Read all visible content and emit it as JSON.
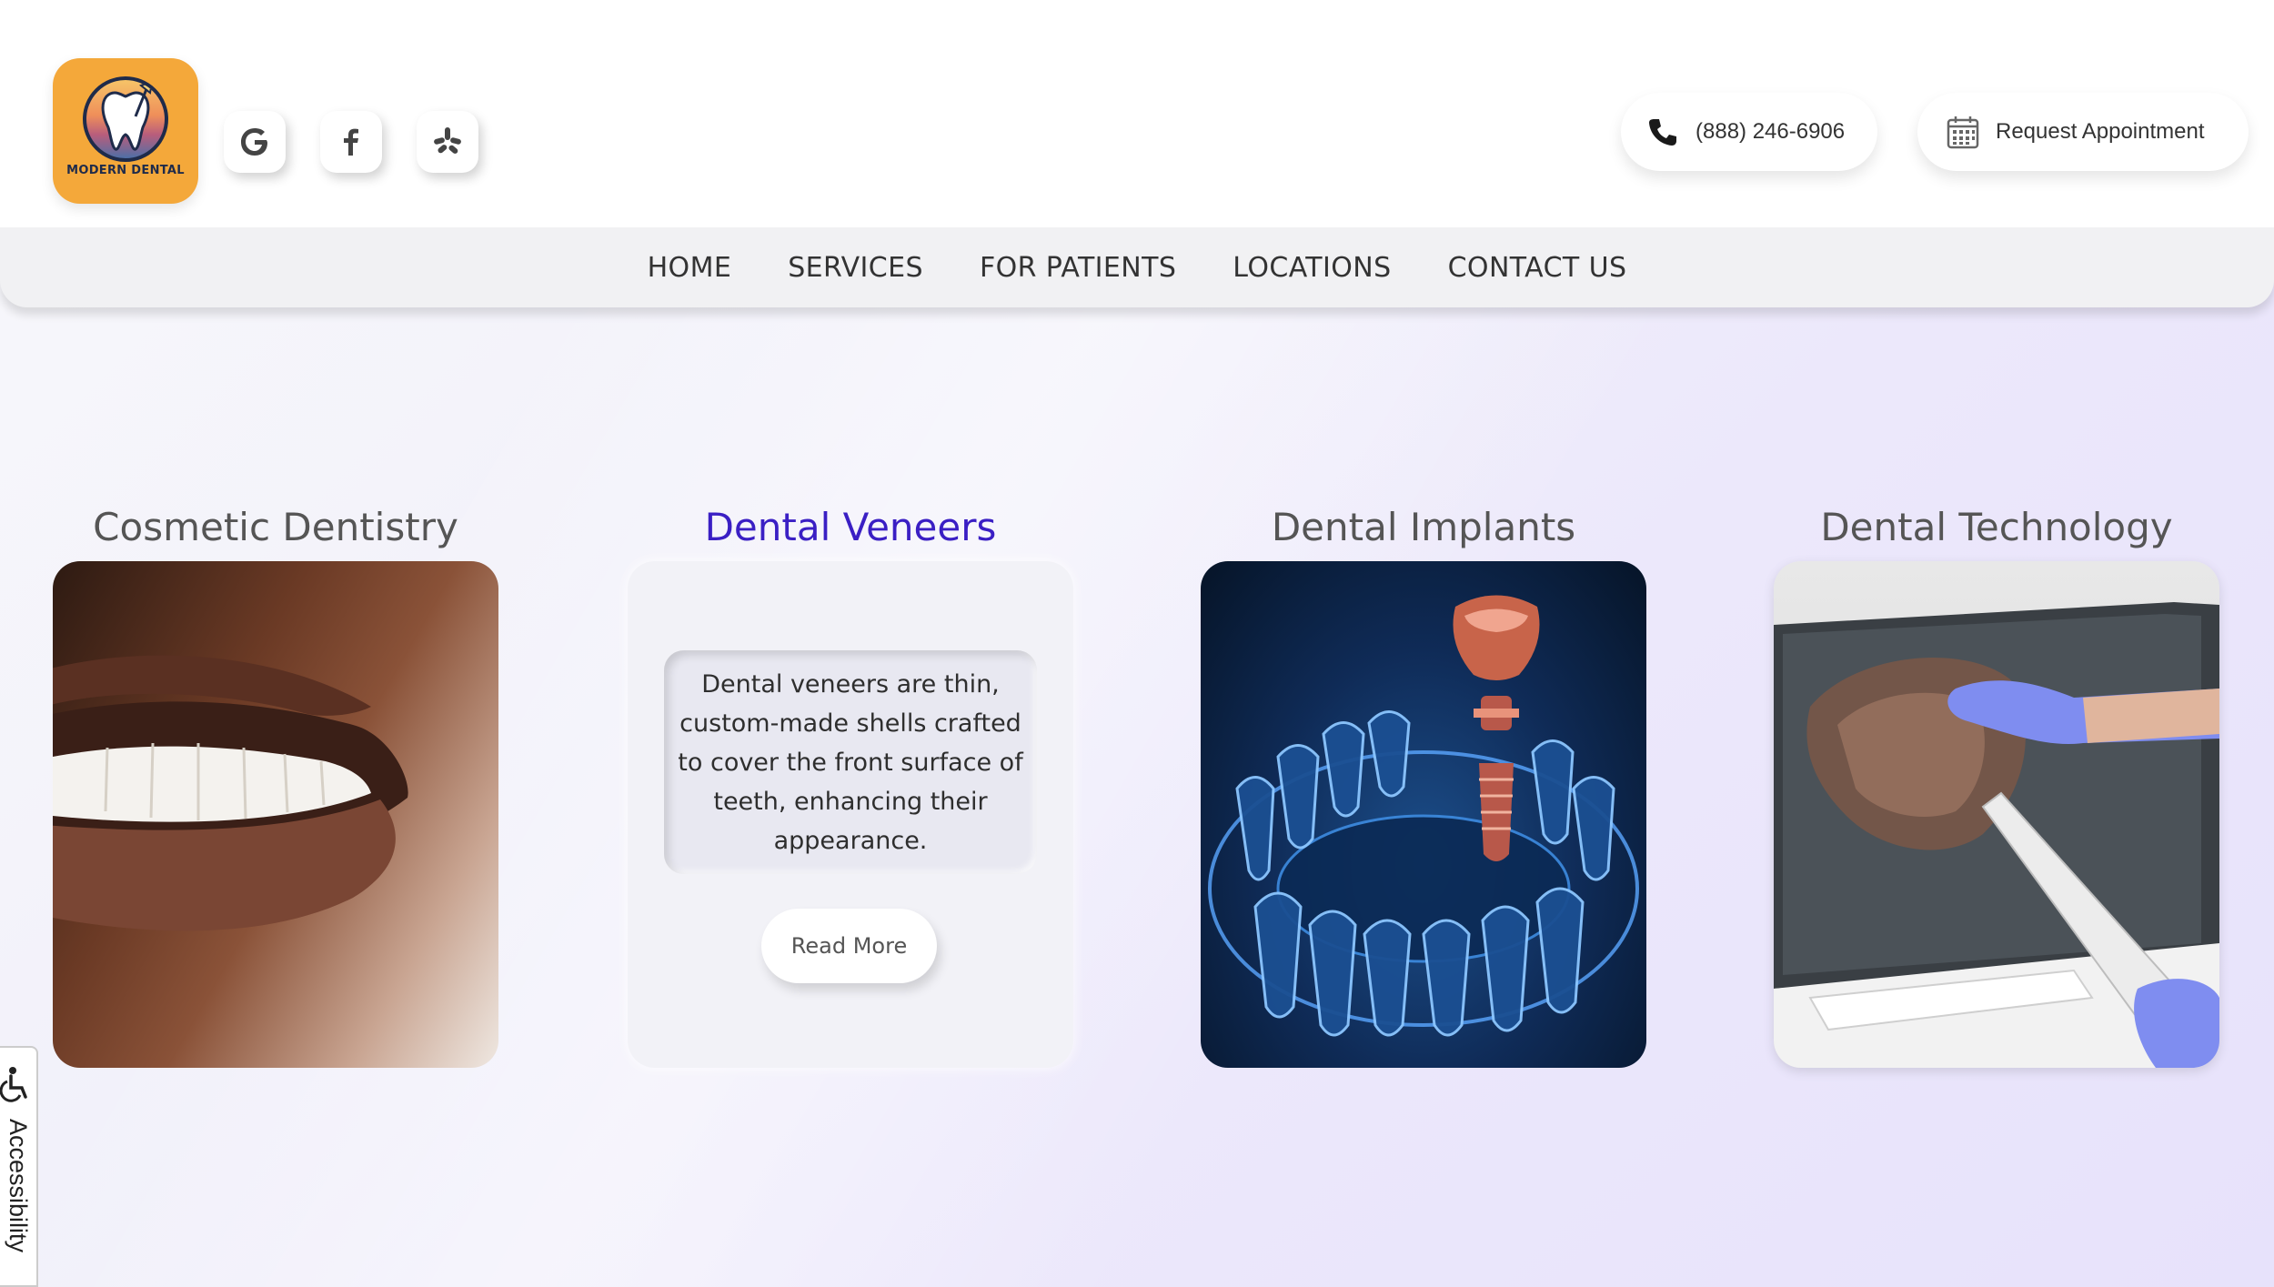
{
  "brand": {
    "logo_text": "MODERN DENTAL",
    "logo_color": "#f4a83a"
  },
  "social": [
    {
      "name": "Google",
      "icon": "google-icon"
    },
    {
      "name": "Facebook",
      "icon": "facebook-icon"
    },
    {
      "name": "Yelp",
      "icon": "yelp-icon"
    }
  ],
  "header": {
    "phone": "(888) 246-6906",
    "appointment_label": "Request Appointment"
  },
  "nav": {
    "items": [
      "HOME",
      "SERVICES",
      "FOR PATIENTS",
      "LOCATIONS",
      "CONTACT US"
    ]
  },
  "cards": [
    {
      "title": "Cosmetic Dentistry",
      "image": "smile-photo"
    },
    {
      "title": "Dental Veneers",
      "description": "Dental veneers are thin, custom-made shells crafted to cover the front surface of teeth, enhancing their appearance.",
      "button": "Read More",
      "active": true,
      "accent": "#3a1fc4"
    },
    {
      "title": "Dental Implants",
      "image": "implant-xray-illustration"
    },
    {
      "title": "Dental Technology",
      "image": "intraoral-scanner-photo"
    }
  ],
  "accessibility": {
    "label": "Accessibility",
    "icon": "wheelchair-icon"
  }
}
